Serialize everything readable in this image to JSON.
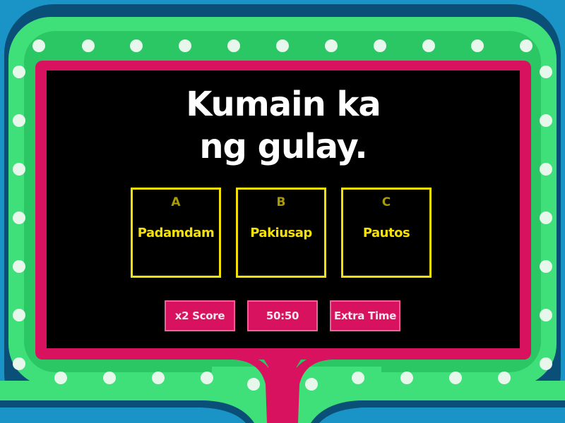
{
  "question": {
    "text": "Kumain ka\nng gulay."
  },
  "answers": [
    {
      "letter": "A",
      "label": "Padamdam"
    },
    {
      "letter": "B",
      "label": "Pakiusap"
    },
    {
      "letter": "C",
      "label": "Pautos"
    }
  ],
  "powerups": [
    {
      "label": "x2 Score"
    },
    {
      "label": "50:50"
    },
    {
      "label": "Extra Time"
    }
  ],
  "colors": {
    "background": "#1a93c7",
    "frame_green": "#3fe07a",
    "frame_dark": "#0e7a55",
    "frame_pink": "#d8125f",
    "answer_border": "#f5e10a",
    "powerup": "#d8125f"
  }
}
